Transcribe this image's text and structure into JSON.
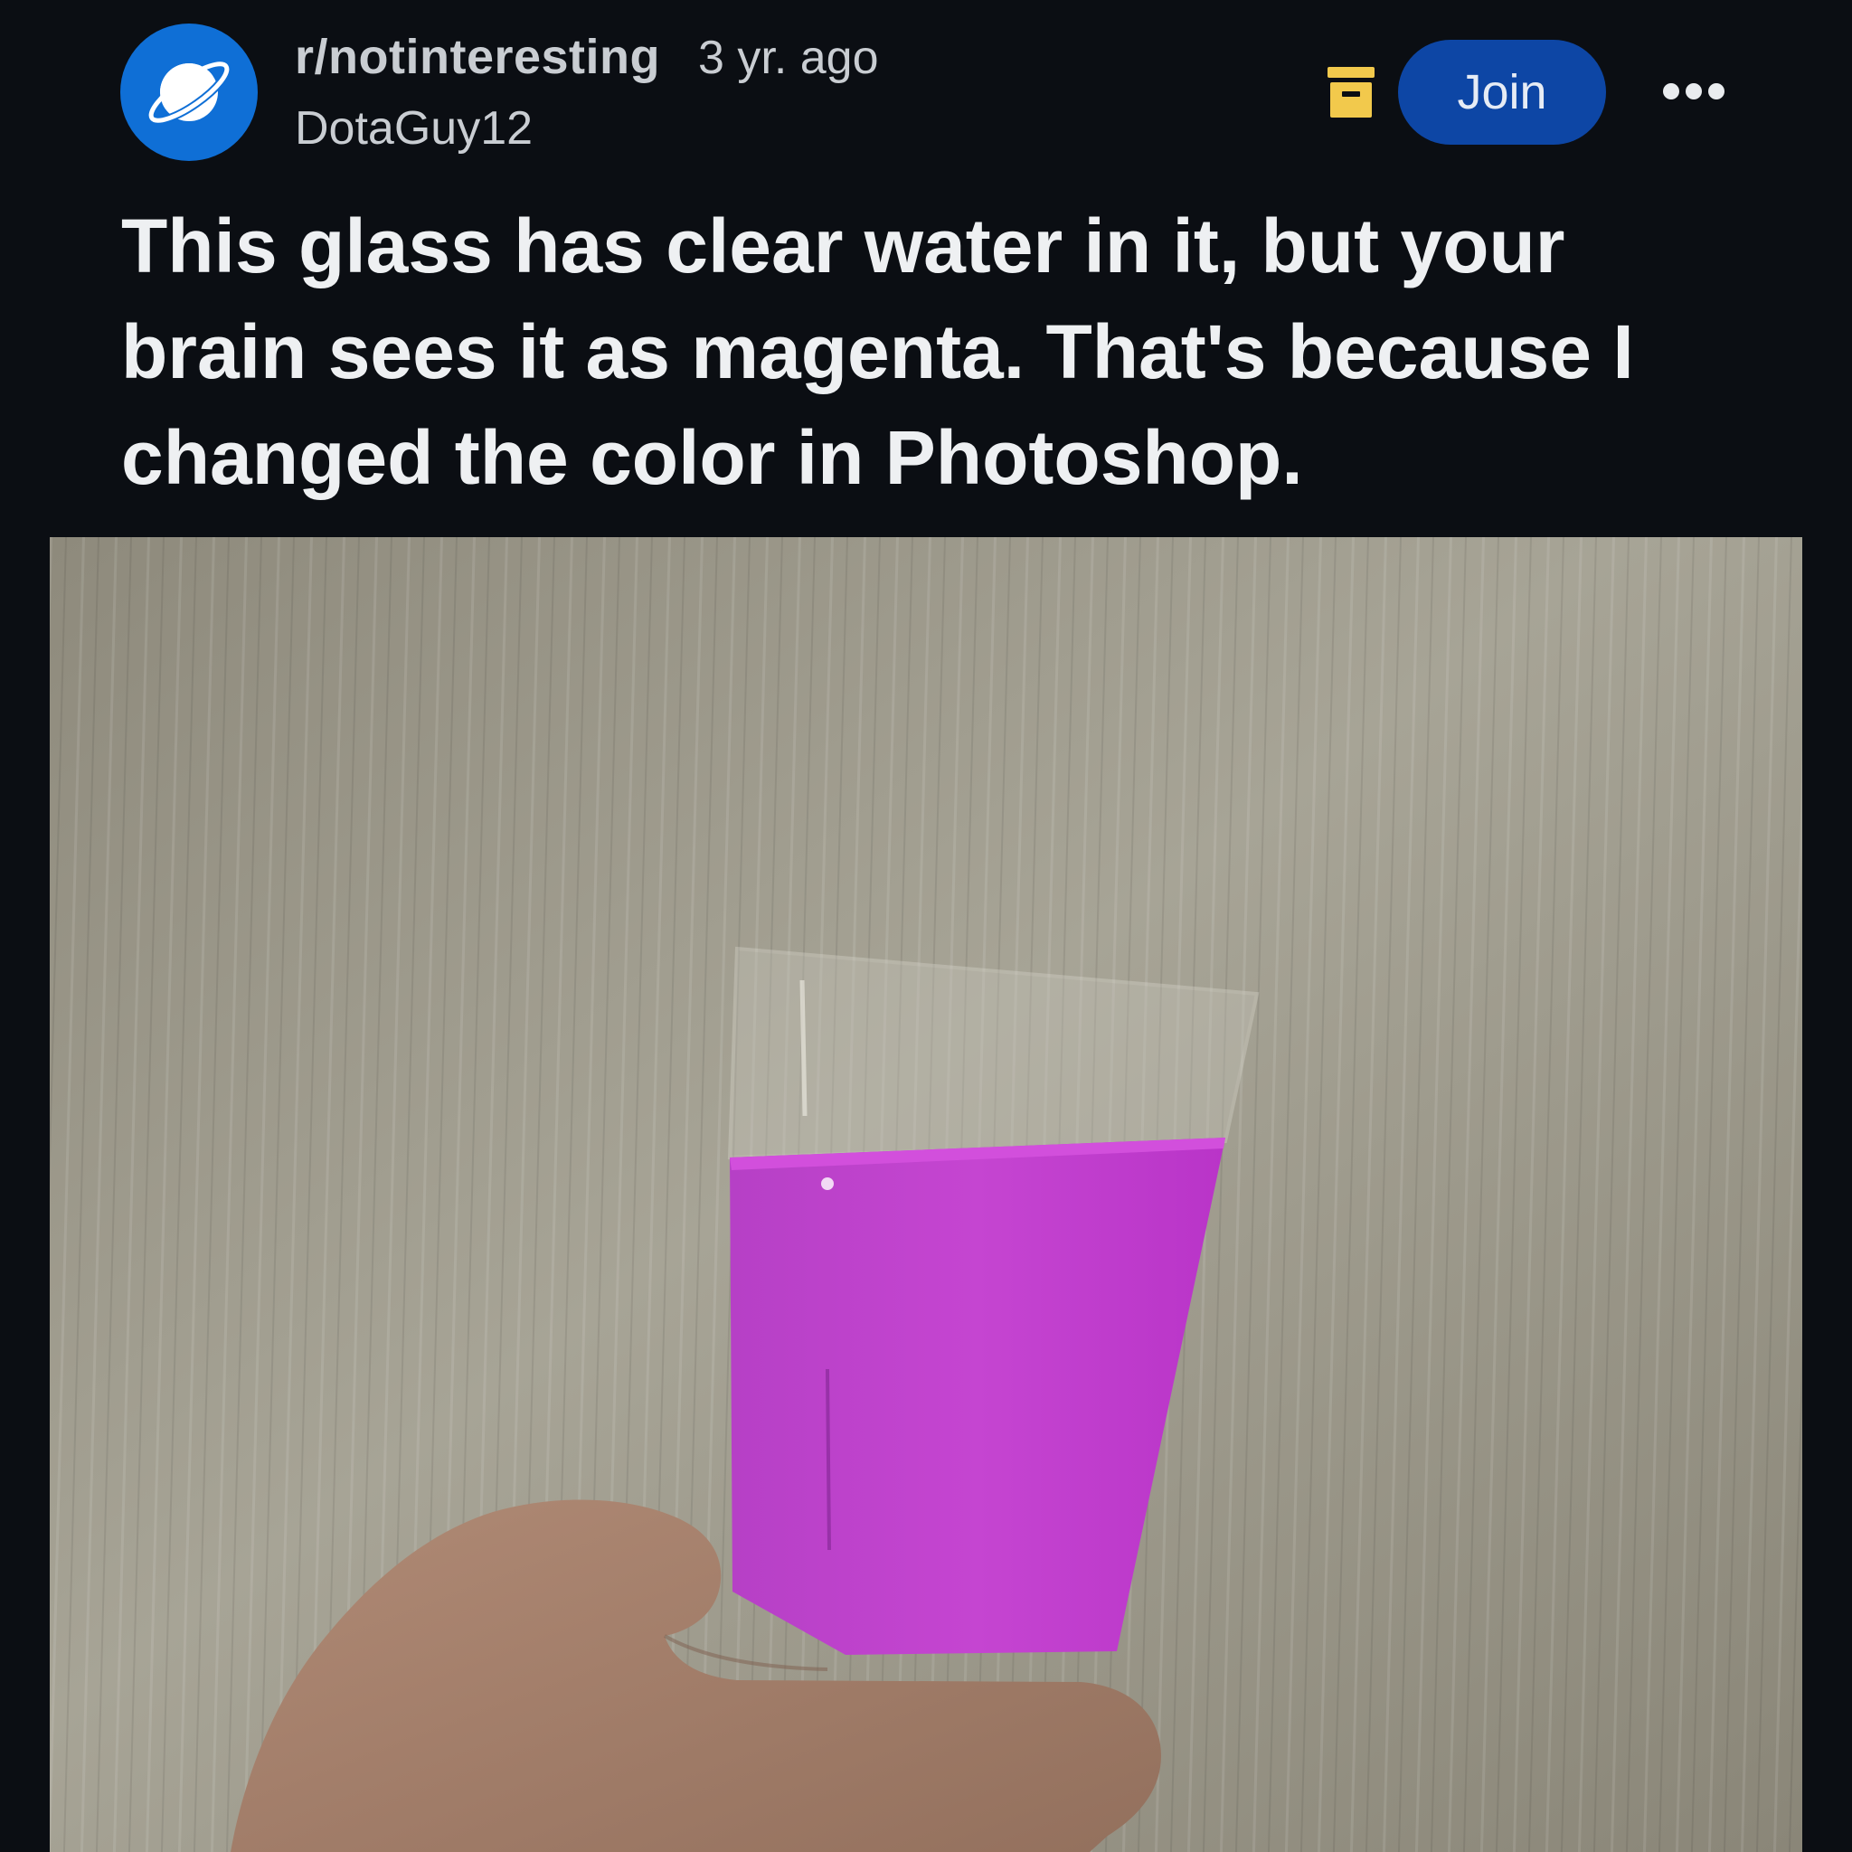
{
  "post": {
    "subreddit": "r/notinteresting",
    "time": "3 yr. ago",
    "username": "DotaGuy12",
    "title": "This glass has clear water in it, but your brain sees it as magenta. That's because I changed the color in Photoshop."
  },
  "actions": {
    "join_label": "Join"
  },
  "icons": {
    "avatar": "planet-icon",
    "archive": "archive-icon",
    "more": "more-options-icon"
  },
  "colors": {
    "background": "#0b0e13",
    "join_button": "#0d46a5",
    "avatar": "#0f6fd6",
    "archive_icon": "#f2c94c",
    "water": "#c23dd0"
  }
}
